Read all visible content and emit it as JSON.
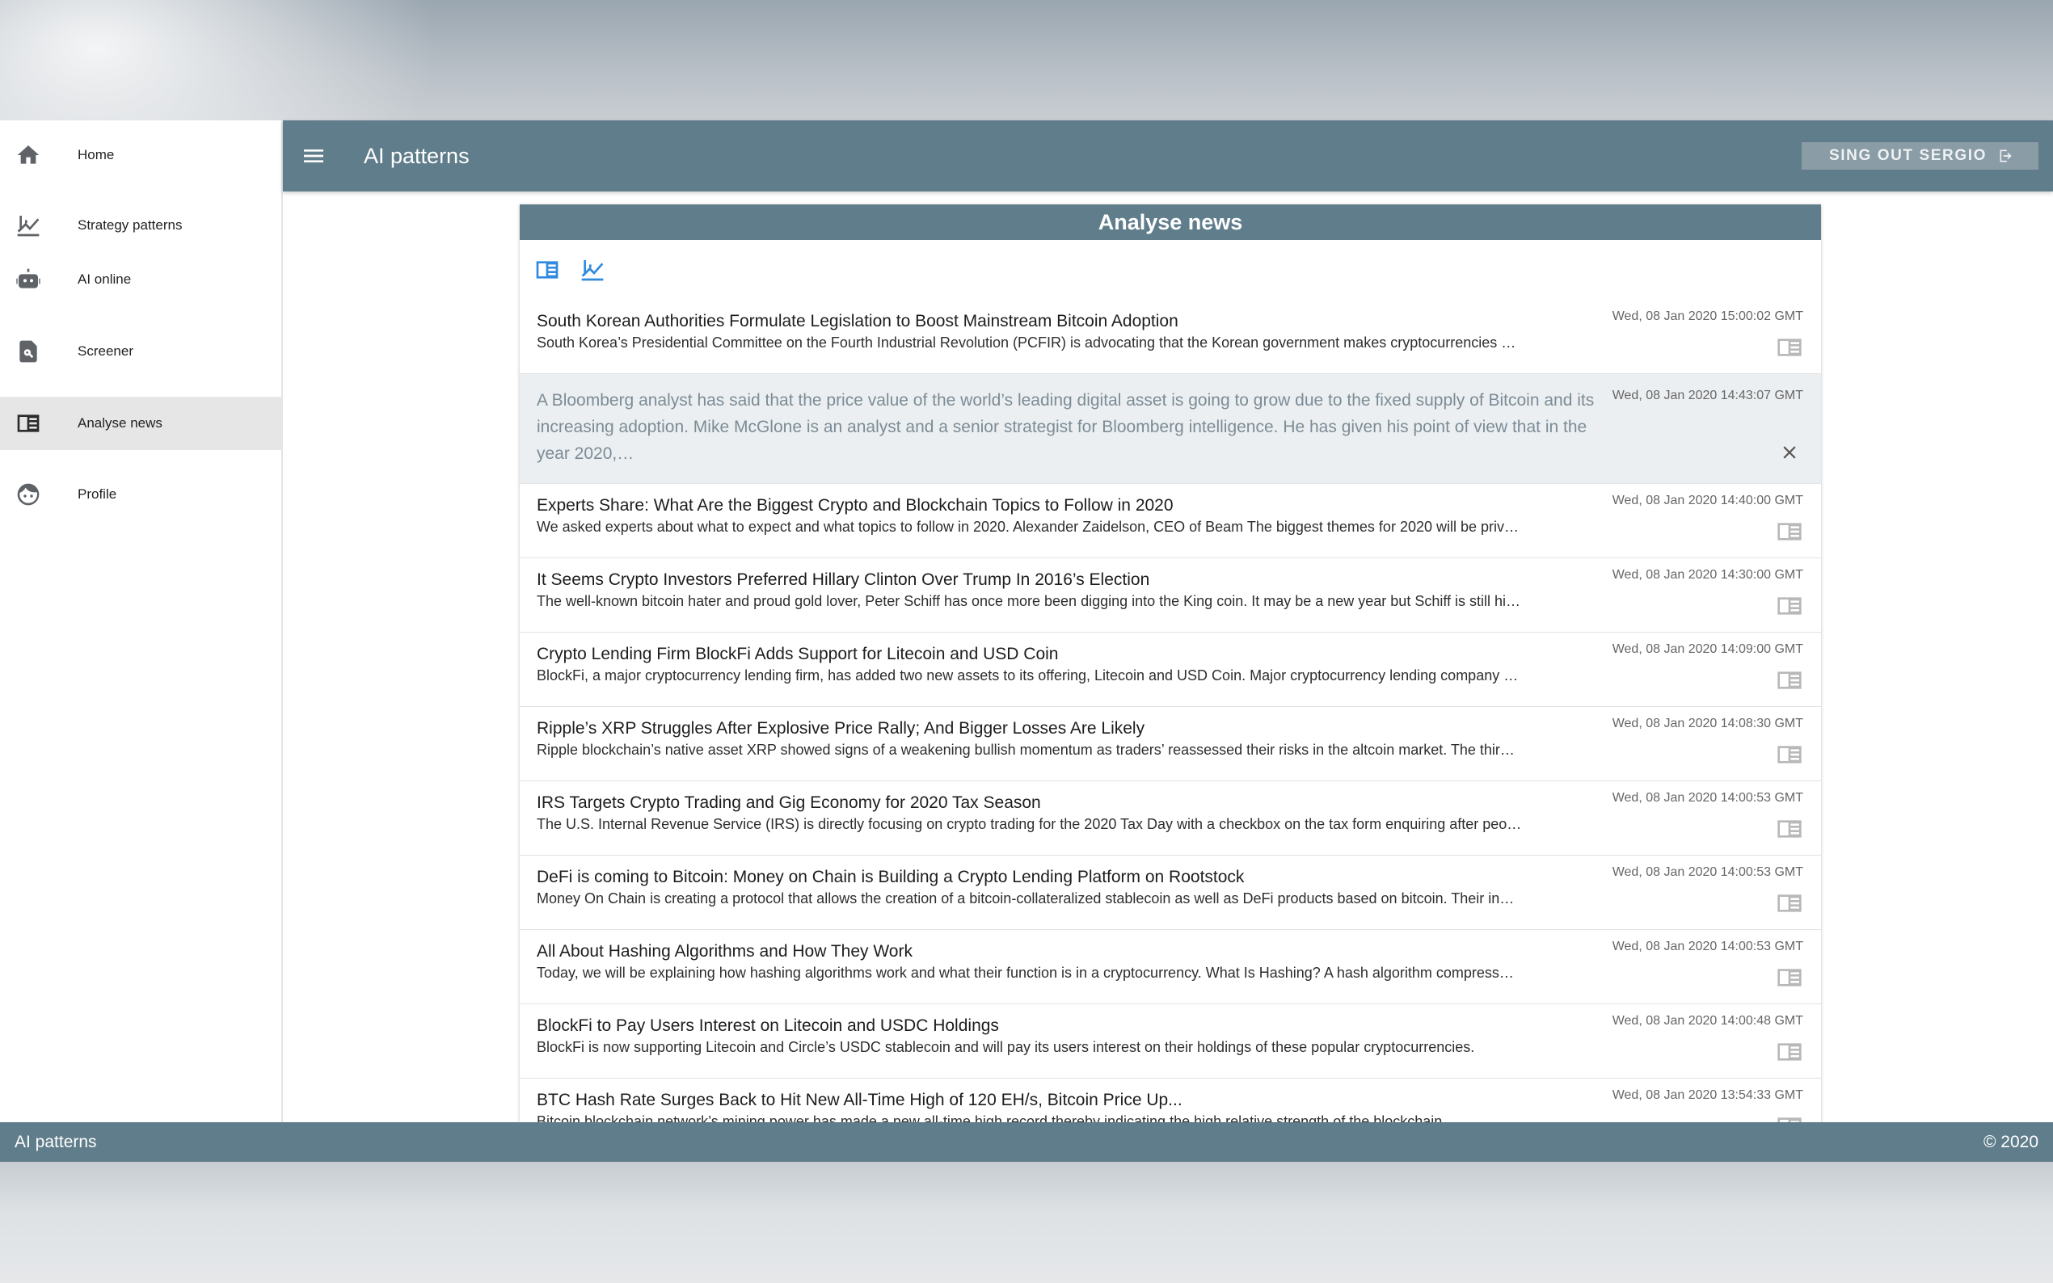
{
  "app": {
    "title": "AI patterns"
  },
  "sidebar": {
    "items": [
      {
        "label": "Home",
        "icon": "home-icon"
      },
      {
        "label": "Strategy patterns",
        "icon": "chart-icon"
      },
      {
        "label": "AI online",
        "icon": "robot-icon"
      },
      {
        "label": "Screener",
        "icon": "search-document-icon"
      },
      {
        "label": "Analyse news",
        "icon": "news-icon",
        "active": true
      },
      {
        "label": "Profile",
        "icon": "face-icon"
      }
    ]
  },
  "header": {
    "title": "AI patterns",
    "signout_label": "SING OUT SERGIO"
  },
  "card": {
    "title": "Analyse news"
  },
  "news": [
    {
      "title": "South Korean Authorities Formulate Legislation to Boost Mainstream Bitcoin Adoption",
      "desc": "South Korea’s Presidential Committee on the Fourth Industrial Revolution (PCFIR) is advocating that the Korean government makes cryptocurrencies …",
      "date": "Wed, 08 Jan 2020 15:00:02 GMT"
    },
    {
      "expanded": true,
      "full": "A Bloomberg analyst has said that the price value of the world’s leading digital asset is going to grow due to the fixed supply of Bitcoin and its increasing adoption. Mike McGlone is an analyst and a senior strategist for Bloomberg intelligence. He has given his point of view that in the year 2020,…",
      "date": "Wed, 08 Jan 2020 14:43:07 GMT"
    },
    {
      "title": "Experts Share: What Are the Biggest Crypto and Blockchain Topics to Follow in 2020",
      "desc": "We asked experts about what to expect and what topics to follow in 2020. Alexander Zaidelson, CEO of Beam The biggest themes for 2020 will be priv…",
      "date": "Wed, 08 Jan 2020 14:40:00 GMT"
    },
    {
      "title": "It Seems Crypto Investors Preferred Hillary Clinton Over Trump In 2016’s Election",
      "desc": "The well-known bitcoin hater and proud gold lover, Peter Schiff has once more been digging into the King coin. It may be a new year but Schiff is still hi…",
      "date": "Wed, 08 Jan 2020 14:30:00 GMT"
    },
    {
      "title": "Crypto Lending Firm BlockFi Adds Support for Litecoin and USD Coin",
      "desc": "BlockFi, a major cryptocurrency lending firm, has added two new assets to its offering, Litecoin and USD Coin. Major cryptocurrency lending company …",
      "date": "Wed, 08 Jan 2020 14:09:00 GMT"
    },
    {
      "title": "Ripple’s XRP Struggles After Explosive Price Rally; And Bigger Losses Are Likely",
      "desc": "Ripple blockchain’s native asset XRP showed signs of a weakening bullish momentum as traders’ reassessed their risks in the altcoin market. The thir…",
      "date": "Wed, 08 Jan 2020 14:08:30 GMT"
    },
    {
      "title": "IRS Targets Crypto Trading and Gig Economy for 2020 Tax Season",
      "desc": "The U.S. Internal Revenue Service (IRS) is directly focusing on crypto trading for the 2020 Tax Day with a checkbox on the tax form enquiring after peo…",
      "date": "Wed, 08 Jan 2020 14:00:53 GMT"
    },
    {
      "title": "DeFi is coming to Bitcoin: Money on Chain is Building a Crypto Lending Platform on Rootstock",
      "desc": "Money On Chain is creating a protocol that allows the creation of a bitcoin-collateralized stablecoin as well as DeFi products based on bitcoin. Their in…",
      "date": "Wed, 08 Jan 2020 14:00:53 GMT"
    },
    {
      "title": "All About Hashing Algorithms and How They Work",
      "desc": "Today, we will be explaining how hashing algorithms work and what their function is in a cryptocurrency. What Is Hashing? A hash algorithm compress…",
      "date": "Wed, 08 Jan 2020 14:00:53 GMT"
    },
    {
      "title": "BlockFi to Pay Users Interest on Litecoin and USDC Holdings",
      "desc": "BlockFi is now supporting Litecoin and Circle’s USDC stablecoin and will pay its users interest on their holdings of these popular cryptocurrencies.",
      "date": "Wed, 08 Jan 2020 14:00:48 GMT"
    },
    {
      "title": "BTC Hash Rate Surges Back to Hit New All-Time High of 120 EH/s, Bitcoin Price Up...",
      "desc": "Bitcoin blockchain network’s mining power has made a new all-time high record thereby indicating the high relative strength of the blockchain.",
      "date": "Wed, 08 Jan 2020 13:54:33 GMT"
    }
  ],
  "footer": {
    "left": "AI patterns",
    "right": "© 2020"
  },
  "colors": {
    "primary": "#607d8b",
    "accent": "#2f8ae0",
    "signout_bg": "#8a9ca6"
  }
}
